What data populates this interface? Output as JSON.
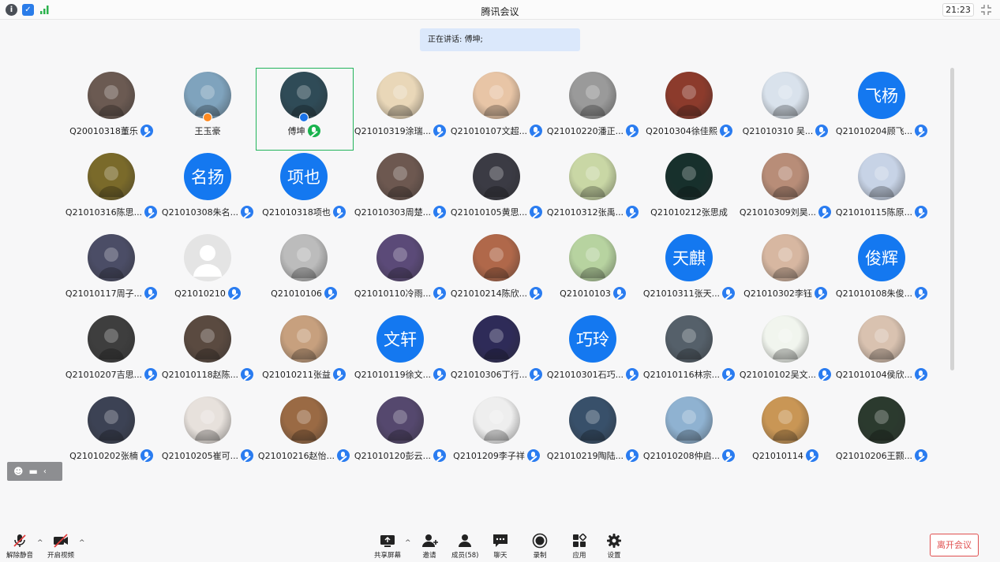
{
  "window": {
    "title": "腾讯会议",
    "time": "21:23"
  },
  "speaking": "正在讲话: 傅坤;",
  "participants": [
    {
      "name": "Q20010318董乐",
      "avatar": "photo",
      "mic": "blue"
    },
    {
      "name": "王玉豪",
      "avatar": "photo",
      "mic": "none",
      "role_badge": "host"
    },
    {
      "name": "傅坤",
      "avatar": "photo",
      "mic": "green",
      "role_badge": "cohost",
      "speaking": true
    },
    {
      "name": "Q21010319涂瑞...",
      "avatar": "photo",
      "mic": "blue"
    },
    {
      "name": "Q21010107文超...",
      "avatar": "photo",
      "mic": "blue"
    },
    {
      "name": "Q21010220潘正...",
      "avatar": "photo",
      "mic": "blue"
    },
    {
      "name": "Q2010304徐佳熙",
      "avatar": "photo",
      "mic": "blue"
    },
    {
      "name": "Q21010310 吴...",
      "avatar": "photo",
      "mic": "blue"
    },
    {
      "name": "Q21010204顾飞...",
      "avatar_text": "飞杨",
      "mic": "blue"
    },
    {
      "name": "Q21010316陈思...",
      "avatar": "photo",
      "mic": "blue"
    },
    {
      "name": "Q21010308朱名...",
      "avatar_text": "名扬",
      "mic": "blue"
    },
    {
      "name": "Q21010318项也",
      "avatar_text": "项也",
      "mic": "blue"
    },
    {
      "name": "Q21010303周楚...",
      "avatar": "photo",
      "mic": "blue"
    },
    {
      "name": "Q21010105黄思...",
      "avatar": "photo",
      "mic": "blue"
    },
    {
      "name": "Q21010312张禹...",
      "avatar": "photo",
      "mic": "blue"
    },
    {
      "name": "Q21010212张思成",
      "avatar": "photo",
      "mic": "none"
    },
    {
      "name": "Q21010309刘昊...",
      "avatar": "photo",
      "mic": "blue"
    },
    {
      "name": "Q21010115陈原...",
      "avatar": "photo",
      "mic": "blue"
    },
    {
      "name": "Q21010117周子...",
      "avatar": "photo",
      "mic": "blue"
    },
    {
      "name": "Q21010210",
      "avatar": "default",
      "mic": "blue"
    },
    {
      "name": "Q21010106",
      "avatar": "photo",
      "mic": "blue"
    },
    {
      "name": "Q21010110冷雨...",
      "avatar": "photo",
      "mic": "blue"
    },
    {
      "name": "Q21010214陈欣...",
      "avatar": "photo",
      "mic": "blue"
    },
    {
      "name": "Q21010103",
      "avatar": "photo",
      "mic": "blue"
    },
    {
      "name": "Q21010311张天...",
      "avatar_text": "天麒",
      "mic": "blue"
    },
    {
      "name": "Q21010302李钰",
      "avatar": "photo",
      "mic": "blue"
    },
    {
      "name": "Q21010108朱俊...",
      "avatar_text": "俊辉",
      "mic": "blue"
    },
    {
      "name": "Q21010207吉思...",
      "avatar": "photo",
      "mic": "blue"
    },
    {
      "name": "Q21010118赵陈...",
      "avatar": "photo",
      "mic": "blue"
    },
    {
      "name": "Q21010211张益",
      "avatar": "photo",
      "mic": "blue"
    },
    {
      "name": "Q21010119徐文...",
      "avatar_text": "文轩",
      "mic": "blue"
    },
    {
      "name": "Q21010306丁行...",
      "avatar": "photo",
      "mic": "blue"
    },
    {
      "name": "Q21010301石巧...",
      "avatar_text": "巧玲",
      "mic": "blue"
    },
    {
      "name": "Q21010116林宗...",
      "avatar": "photo",
      "mic": "blue"
    },
    {
      "name": "Q21010102吴文...",
      "avatar": "photo",
      "mic": "blue"
    },
    {
      "name": "Q21010104侯欣...",
      "avatar": "photo",
      "mic": "blue"
    },
    {
      "name": "Q21010202张楠",
      "avatar": "photo",
      "mic": "blue"
    },
    {
      "name": "Q21010205崔可...",
      "avatar": "photo",
      "mic": "blue"
    },
    {
      "name": "Q21010216赵怡...",
      "avatar": "photo",
      "mic": "blue"
    },
    {
      "name": "Q21010120彭云...",
      "avatar": "photo",
      "mic": "blue"
    },
    {
      "name": "Q2101209李子祥",
      "avatar": "photo",
      "mic": "blue"
    },
    {
      "name": "Q21010219陶陆...",
      "avatar": "photo",
      "mic": "blue"
    },
    {
      "name": "Q21010208仲启...",
      "avatar": "photo",
      "mic": "blue"
    },
    {
      "name": "Q21010114",
      "avatar": "photo",
      "mic": "blue"
    },
    {
      "name": "Q21010206王颢...",
      "avatar": "photo",
      "mic": "blue"
    }
  ],
  "toolbar": {
    "unmute": "解除静音",
    "start_video": "开启视频",
    "share_screen": "共享屏幕",
    "invite": "邀请",
    "members": "成员(58)",
    "chat": "聊天",
    "record": "录制",
    "apps": "应用",
    "settings": "设置",
    "leave": "离开会议"
  },
  "colors": {
    "accent": "#1478f0",
    "speaking_border": "#22b45b",
    "leave": "#e04f4f"
  }
}
